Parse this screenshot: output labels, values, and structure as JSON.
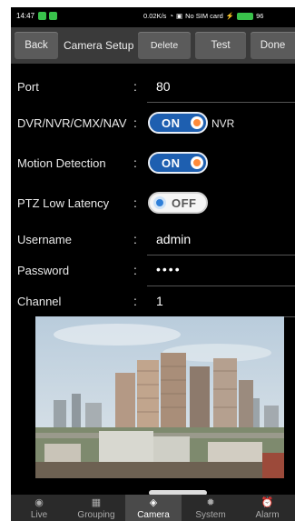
{
  "status_bar": {
    "time": "14:47",
    "network": "0.02K/s",
    "sim": "No SIM card",
    "battery": "96"
  },
  "toolbar": {
    "back_label": "Back",
    "title": "Camera Setup",
    "delete_label": "Delete",
    "test_label": "Test",
    "done_label": "Done"
  },
  "fields": {
    "port": {
      "label": "Port",
      "value": "80"
    },
    "dvr": {
      "label": "DVR/NVR/CMX/NAV",
      "toggle": "ON",
      "suffix": "NVR"
    },
    "motion": {
      "label": "Motion Detection",
      "toggle": "ON"
    },
    "ptz": {
      "label": "PTZ Low Latency",
      "toggle": "OFF"
    },
    "username": {
      "label": "Username",
      "value": "admin"
    },
    "password": {
      "label": "Password",
      "value": "••••"
    },
    "channel": {
      "label": "Channel",
      "value": "1"
    }
  },
  "colon": ":",
  "bottom_nav": [
    {
      "label": "Live",
      "icon": "live-icon"
    },
    {
      "label": "Grouping",
      "icon": "grouping-icon"
    },
    {
      "label": "Camera",
      "icon": "camera-icon"
    },
    {
      "label": "System",
      "icon": "system-icon"
    },
    {
      "label": "Alarm",
      "icon": "alarm-icon"
    }
  ],
  "colors": {
    "toggle_on": "#1e5fb0",
    "knob_on": "#ff8a3a",
    "toolbar": "#3a3a3a",
    "background": "#000000"
  }
}
